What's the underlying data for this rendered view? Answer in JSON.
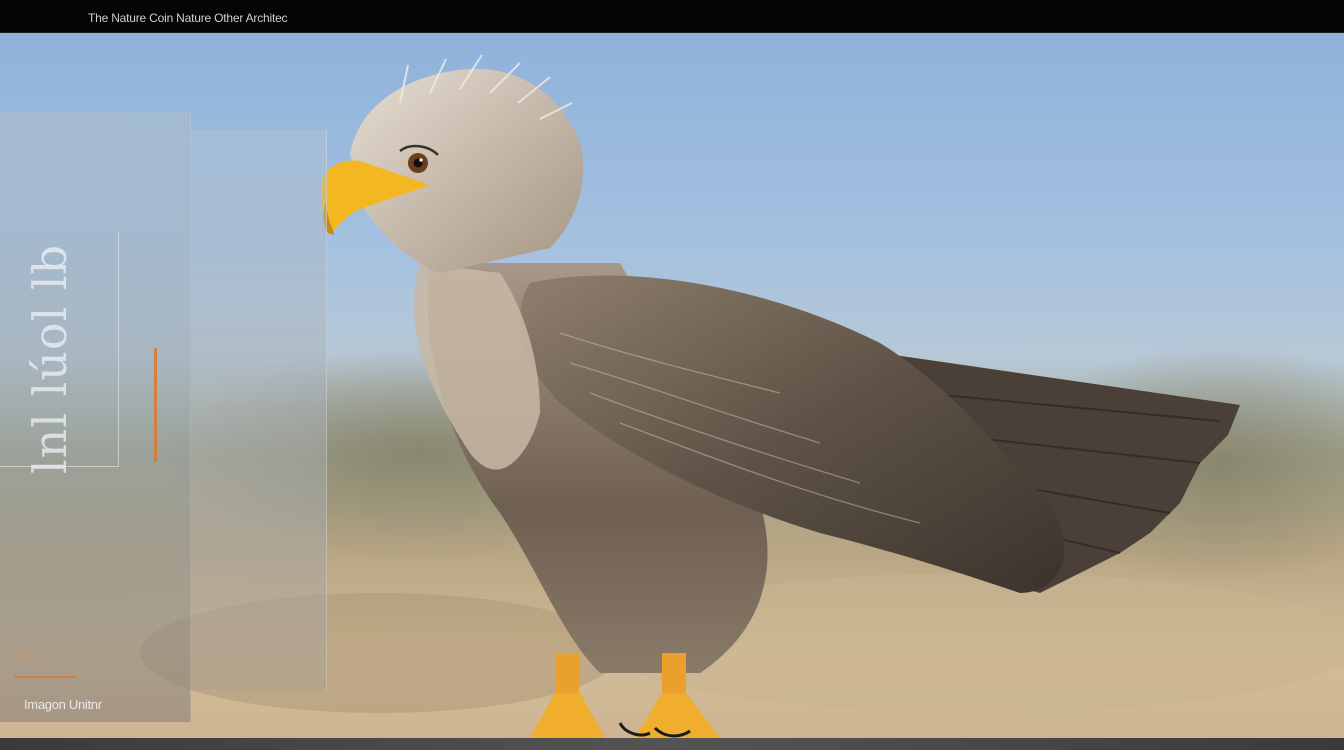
{
  "topbar": {
    "title": "The Nature Coin Nature Other Architec"
  },
  "overlay": {
    "vertical_label": "lnl lúol lb",
    "small_tag": "Gbs",
    "caption": "Imagon Unitnr"
  },
  "subject": {
    "description_icon": "eagle-illustration"
  },
  "colors": {
    "sky": "#8fb2da",
    "ground": "#d2bc97",
    "accent_orange": "#d9782c",
    "beak_yellow": "#f3b821"
  }
}
